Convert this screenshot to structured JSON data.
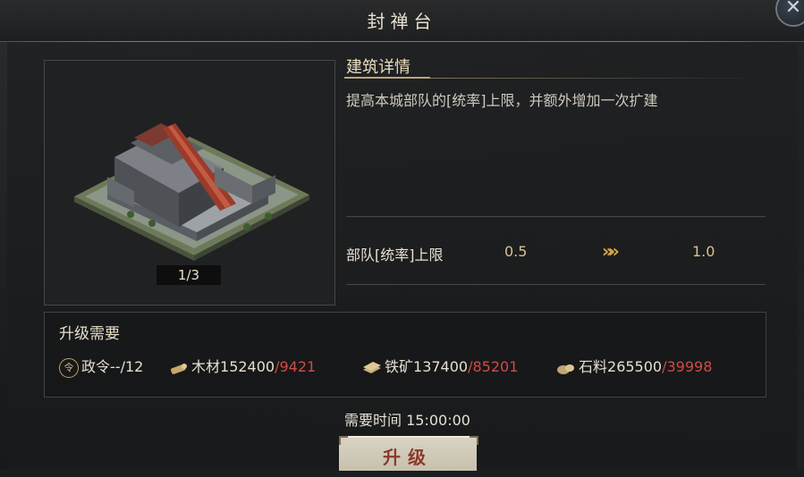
{
  "window": {
    "title": "封禅台"
  },
  "building": {
    "image_counter": "1/3"
  },
  "details": {
    "section_title": "建筑详情",
    "description": "提高本城部队的[统率]上限，并额外增加一次扩建",
    "stat": {
      "label": "部队[统率]上限",
      "from": "0.5",
      "arrow": "»»",
      "to": "1.0"
    }
  },
  "requirements": {
    "title": "升级需要",
    "items": [
      {
        "icon": "order-seal-icon",
        "name": "政令",
        "have": "--",
        "need": "/12"
      },
      {
        "icon": "wood-icon",
        "name": "木材",
        "have": "152400",
        "need": "/9421"
      },
      {
        "icon": "iron-ore-icon",
        "name": "铁矿",
        "have": "137400",
        "need": "/85201"
      },
      {
        "icon": "stone-icon",
        "name": "石料",
        "have": "265500",
        "need": "/39998"
      }
    ]
  },
  "time": {
    "label": "需要时间",
    "value": "15:00:00"
  },
  "upgrade_button": {
    "label": "升级"
  },
  "colors": {
    "accent_gold": "#d8c28e",
    "insufficient_red": "#d14b44",
    "button_text": "#8a3a2a"
  }
}
